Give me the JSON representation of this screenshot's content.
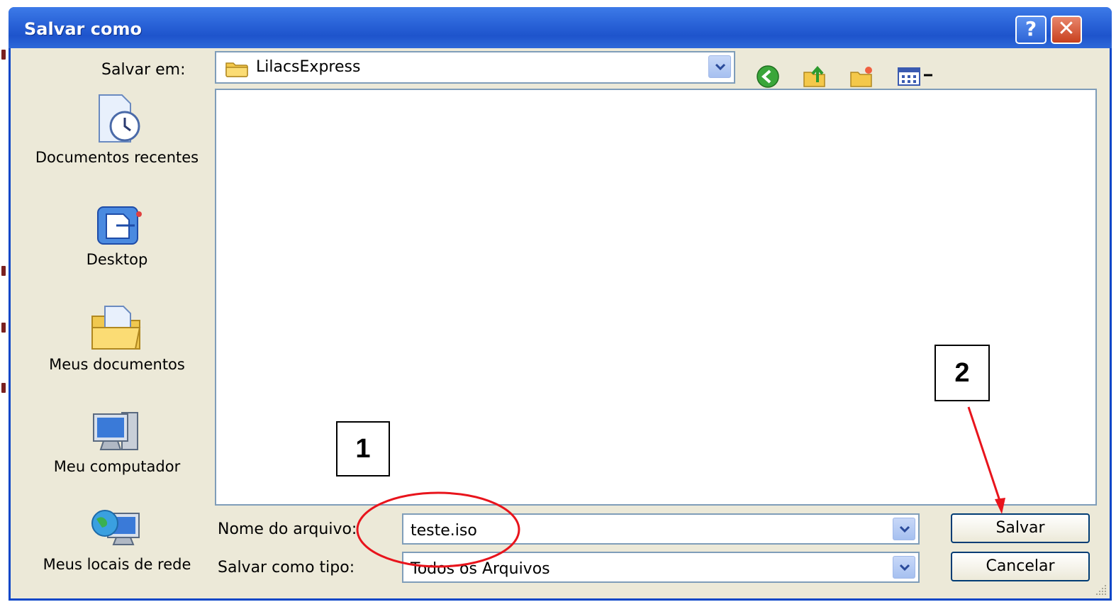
{
  "window": {
    "title": "Salvar como",
    "help_glyph": "?",
    "close_glyph": "✕"
  },
  "location": {
    "label": "Salvar em:",
    "value": "LilacsExpress",
    "icon": "folder-icon"
  },
  "toolbar": {
    "icons": [
      "back-arrow-icon",
      "up-folder-icon",
      "new-folder-icon",
      "view-menu-icon"
    ]
  },
  "places": [
    {
      "label": "Documentos recentes",
      "icon": "recent-documents-icon"
    },
    {
      "label": "Desktop",
      "icon": "desktop-icon"
    },
    {
      "label": "Meus documentos",
      "icon": "my-documents-icon"
    },
    {
      "label": "Meu computador",
      "icon": "my-computer-icon"
    },
    {
      "label": "Meus locais de rede",
      "icon": "network-places-icon"
    }
  ],
  "filename": {
    "label": "Nome do arquivo:",
    "value": "teste.iso"
  },
  "filetype": {
    "label": "Salvar como tipo:",
    "value": "Todos os Arquivos"
  },
  "buttons": {
    "save": "Salvar",
    "cancel": "Cancelar"
  },
  "annotations": {
    "step1": "1",
    "step2": "2",
    "highlight_color": "#e8141c"
  }
}
